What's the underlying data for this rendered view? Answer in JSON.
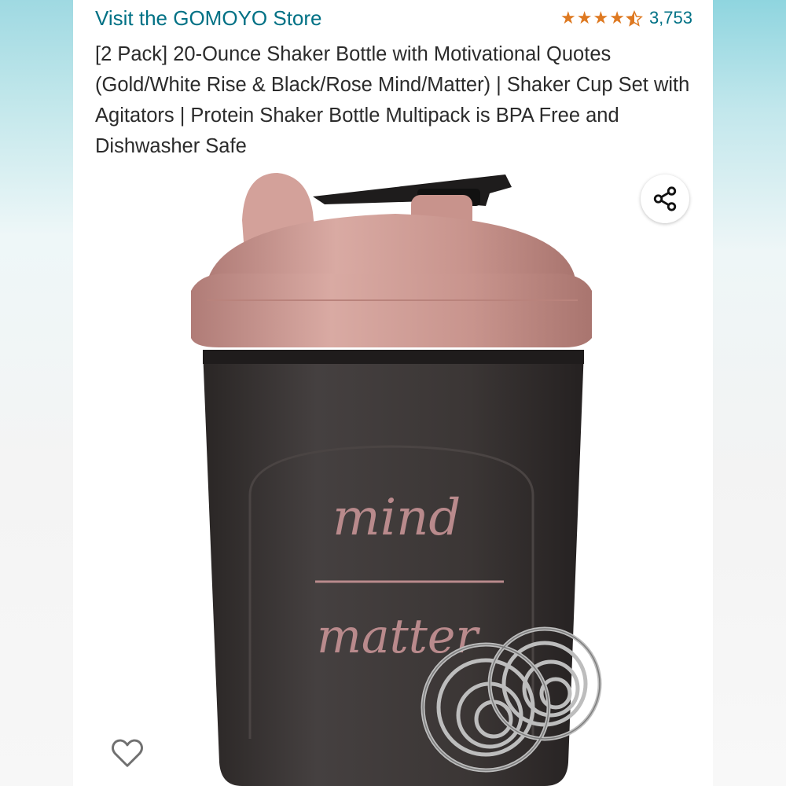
{
  "store": {
    "link_text": "Visit the GOMOYO Store"
  },
  "rating": {
    "stars": 4.5,
    "max_stars": 5,
    "review_count": "3,753",
    "star_color": "#de7921"
  },
  "product": {
    "title": "[2 Pack] 20-Ounce Shaker Bottle with Motivational Quotes (Gold/White Rise & Black/Rose Mind/Matter) | Shaker Cup Set with Agitators | Protein Shaker Bottle Multipack is BPA Free and Dishwasher Safe",
    "image_text_top": "mind",
    "image_text_bottom": "matter"
  },
  "actions": {
    "share_icon": "share-icon",
    "wishlist_icon": "heart-outline-icon"
  },
  "colors": {
    "link": "#007185",
    "lid": "#c9958f",
    "bottle": "#3a3433",
    "print": "#b98a8c"
  }
}
